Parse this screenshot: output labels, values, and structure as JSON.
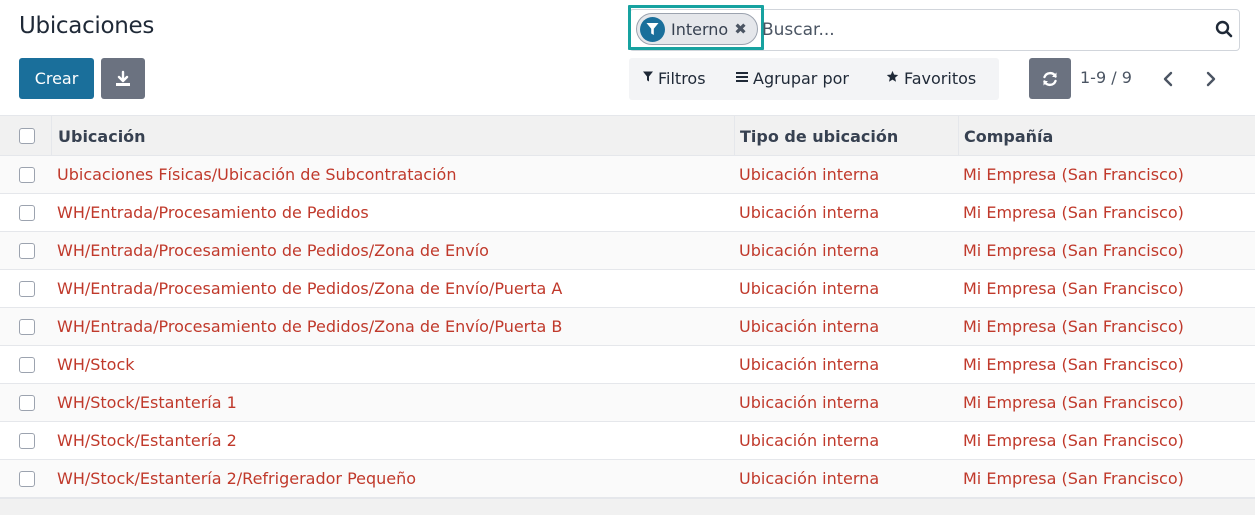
{
  "header": {
    "title": "Ubicaciones",
    "create_label": "Crear"
  },
  "search": {
    "facet_label": "Interno",
    "facet_close": "✖",
    "placeholder": "Buscar..."
  },
  "filters": {
    "filtros": "Filtros",
    "agrupar": "Agrupar por",
    "favoritos": "Favoritos"
  },
  "pager": {
    "value": "1-9 / 9"
  },
  "table": {
    "columns": [
      "Ubicación",
      "Tipo de ubicación",
      "Compañía"
    ],
    "rows": [
      {
        "ubicacion": "Ubicaciones Físicas/Ubicación de Subcontratación",
        "tipo": "Ubicación interna",
        "compania": "Mi Empresa (San Francisco)"
      },
      {
        "ubicacion": "WH/Entrada/Procesamiento de Pedidos",
        "tipo": "Ubicación interna",
        "compania": "Mi Empresa (San Francisco)"
      },
      {
        "ubicacion": "WH/Entrada/Procesamiento de Pedidos/Zona de Envío",
        "tipo": "Ubicación interna",
        "compania": "Mi Empresa (San Francisco)"
      },
      {
        "ubicacion": "WH/Entrada/Procesamiento de Pedidos/Zona de Envío/Puerta A",
        "tipo": "Ubicación interna",
        "compania": "Mi Empresa (San Francisco)"
      },
      {
        "ubicacion": "WH/Entrada/Procesamiento de Pedidos/Zona de Envío/Puerta B",
        "tipo": "Ubicación interna",
        "compania": "Mi Empresa (San Francisco)"
      },
      {
        "ubicacion": "WH/Stock",
        "tipo": "Ubicación interna",
        "compania": "Mi Empresa (San Francisco)"
      },
      {
        "ubicacion": "WH/Stock/Estantería 1",
        "tipo": "Ubicación interna",
        "compania": "Mi Empresa (San Francisco)"
      },
      {
        "ubicacion": "WH/Stock/Estantería 2",
        "tipo": "Ubicación interna",
        "compania": "Mi Empresa (San Francisco)"
      },
      {
        "ubicacion": "WH/Stock/Estantería 2/Refrigerador Pequeño",
        "tipo": "Ubicación interna",
        "compania": "Mi Empresa (San Francisco)"
      }
    ]
  },
  "colors": {
    "primary": "#1a6f9b",
    "link_red": "#c0392b",
    "highlight": "#17a2a0",
    "secondary": "#6b7280"
  },
  "icons": {
    "facet": "funnel-icon",
    "search": "magnifier-icon",
    "download": "download-icon",
    "refresh": "refresh-icon",
    "prev": "chevron-left-icon",
    "next": "chevron-right-icon"
  }
}
